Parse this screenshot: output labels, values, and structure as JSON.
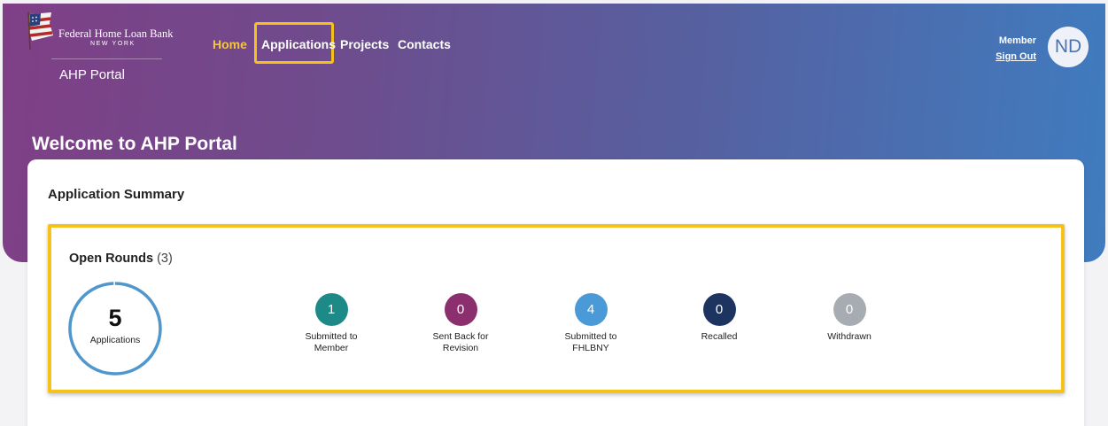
{
  "brand": {
    "name": "Federal Home Loan Bank",
    "city": "NEW YORK",
    "portal": "AHP Portal"
  },
  "nav": {
    "items": [
      {
        "label": "Home",
        "active": true
      },
      {
        "label": "Applications",
        "active": false,
        "highlighted": true
      },
      {
        "label": "Projects",
        "active": false
      },
      {
        "label": "Contacts",
        "active": false
      }
    ]
  },
  "user": {
    "role": "Member",
    "signout": "Sign Out",
    "initials": "ND"
  },
  "page": {
    "welcome": "Welcome to AHP Portal"
  },
  "summary": {
    "title": "Application Summary",
    "rounds_label": "Open Rounds",
    "rounds_count": "(3)",
    "total": {
      "value": "5",
      "label": "Applications"
    },
    "statuses": [
      {
        "value": "1",
        "label_line1": "Submitted to",
        "label_line2": "Member"
      },
      {
        "value": "0",
        "label_line1": "Sent Back for",
        "label_line2": "Revision"
      },
      {
        "value": "4",
        "label_line1": "Submitted to",
        "label_line2": "FHLBNY"
      },
      {
        "value": "0",
        "label_line1": "Recalled",
        "label_line2": ""
      },
      {
        "value": "0",
        "label_line1": "Withdrawn",
        "label_line2": ""
      }
    ]
  },
  "colors": {
    "accent_gold": "#f4c447",
    "highlight_border": "#f6c21a",
    "submitted_to_member": "#1e8a87",
    "sent_back": "#8b2f6e",
    "submitted_to_fhlbny": "#4a9ad8",
    "recalled": "#1d3461",
    "withdrawn": "#a7abb2",
    "ring": "#4f97cc"
  }
}
